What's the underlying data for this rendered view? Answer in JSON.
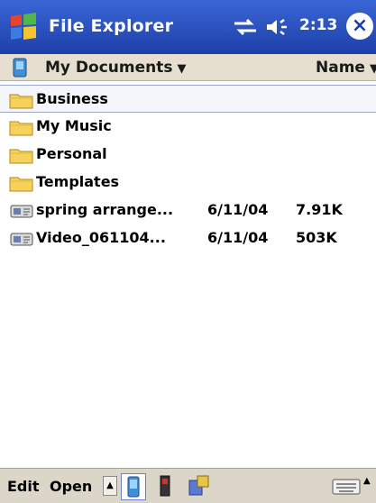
{
  "titlebar": {
    "app_title": "File Explorer",
    "time": "2:13",
    "close_label": "×"
  },
  "navbar": {
    "folder": "My Documents",
    "sort_by": "Name"
  },
  "files": [
    {
      "name": "Business",
      "type": "folder",
      "date": "",
      "size": ""
    },
    {
      "name": "My Music",
      "type": "folder",
      "date": "",
      "size": ""
    },
    {
      "name": "Personal",
      "type": "folder",
      "date": "",
      "size": ""
    },
    {
      "name": "Templates",
      "type": "folder",
      "date": "",
      "size": ""
    },
    {
      "name": "spring arrange...",
      "type": "media",
      "date": "6/11/04",
      "size": "7.91K"
    },
    {
      "name": "Video_061104...",
      "type": "media",
      "date": "6/11/04",
      "size": "503K"
    }
  ],
  "menu": {
    "edit": "Edit",
    "open": "Open"
  },
  "colors": {
    "title_bar": "#2a51c2",
    "nav_bar": "#e6dfcf",
    "folder": "#f6d25a"
  }
}
